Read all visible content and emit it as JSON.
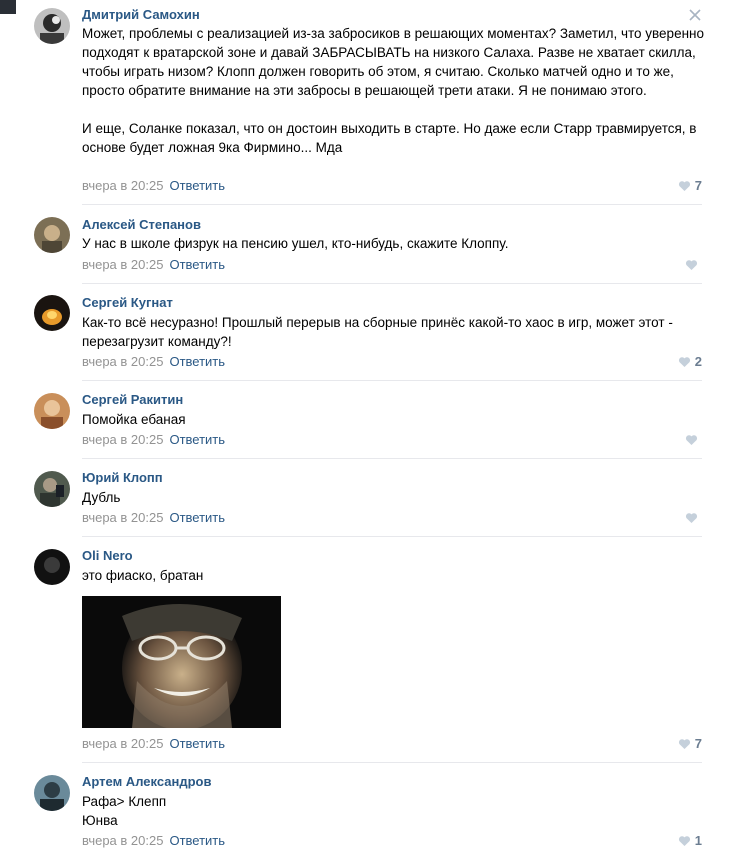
{
  "comments": [
    {
      "author": "Дмитрий Самохин",
      "text": "Может, проблемы с реализацией из-за забросиков в решающих моментах? Заметил, что уверенно подходят к вратарской зоне и давай ЗАБРАСЫВАТЬ на низкого Салаха. Разве не хватает скилла, чтобы играть низом? Клопп должен говорить об этом, я считаю. Сколько матчей одно и то же, просто обратите внимание на эти забросы в решающей трети атаки. Я не понимаю этого.\n\nИ еще, Соланке показал, что он достоин выходить в старте. Но даже если Старр травмируется, в основе будет ложная 9ка Фирмино... Мда",
      "time": "вчера в 20:25",
      "reply": "Ответить",
      "likes": "7"
    },
    {
      "author": "Алексей Степанов",
      "text": "У нас в школе физрук на пенсию ушел, кто-нибудь, скажите Клоппу.",
      "time": "вчера в 20:25",
      "reply": "Ответить",
      "likes": ""
    },
    {
      "author": "Сергей Кугнат",
      "text": "Как-то всё несуразно! Прошлый перерыв на сборные принёс какой-то хаос в игр, может этот - перезагрузит команду?!",
      "time": "вчера в 20:25",
      "reply": "Ответить",
      "likes": "2"
    },
    {
      "author": "Сергей Ракитин",
      "text": "Помойка ебаная",
      "time": "вчера в 20:25",
      "reply": "Ответить",
      "likes": ""
    },
    {
      "author": "Юрий Клопп",
      "text": "Дубль",
      "time": "вчера в 20:25",
      "reply": "Ответить",
      "likes": ""
    },
    {
      "author": "Oli Nero",
      "text": "это фиаско, братан",
      "time": "вчера в 20:25",
      "reply": "Ответить",
      "likes": "7"
    },
    {
      "author": "Артем Александров",
      "text": "Рафа> Клепп\nЮнва",
      "time": "вчера в 20:25",
      "reply": "Ответить",
      "likes": "1"
    }
  ],
  "icons": {
    "close": "close-icon",
    "like": "heart-icon"
  },
  "colors": {
    "author": "#2a5885",
    "meta": "#939393",
    "like": "#6b7d91",
    "divider": "#e7e8ec"
  }
}
